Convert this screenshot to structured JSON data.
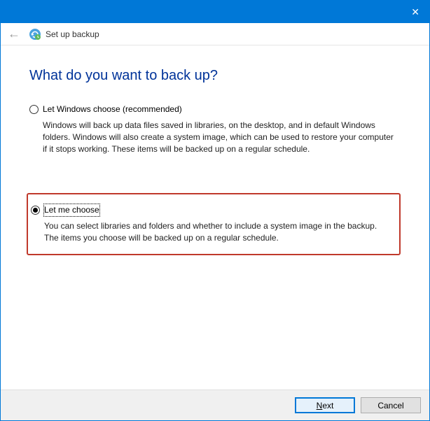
{
  "titlebar": {
    "close": "✕"
  },
  "header": {
    "wizardTitle": "Set up backup"
  },
  "main": {
    "heading": "What do you want to back up?",
    "options": [
      {
        "label": "Let Windows choose (recommended)",
        "desc": "Windows will back up data files saved in libraries, on the desktop, and in default Windows folders. Windows will also create a system image, which can be used to restore your computer if it stops working. These items will be backed up on a regular schedule.",
        "selected": false
      },
      {
        "label": "Let me choose",
        "desc": "You can select libraries and folders and whether to include a system image in the backup. The items you choose will be backed up on a regular schedule.",
        "selected": true
      }
    ]
  },
  "footer": {
    "nextPrefix": "N",
    "nextRest": "ext",
    "cancel": "Cancel"
  }
}
